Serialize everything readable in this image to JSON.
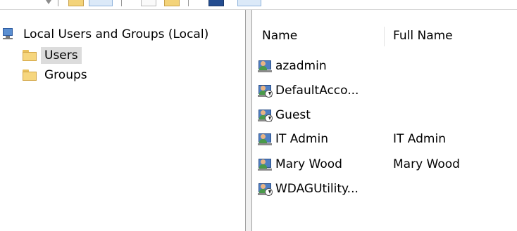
{
  "tree": {
    "root_label": "Local Users and Groups (Local)",
    "items": [
      {
        "label": "Users",
        "selected": true
      },
      {
        "label": "Groups",
        "selected": false
      }
    ]
  },
  "list": {
    "columns": [
      "Name",
      "Full Name"
    ],
    "users": [
      {
        "name": "azadmin",
        "full_name": "",
        "disabled": false
      },
      {
        "name": "DefaultAcco...",
        "full_name": "",
        "disabled": true
      },
      {
        "name": "Guest",
        "full_name": "",
        "disabled": true
      },
      {
        "name": "IT Admin",
        "full_name": "IT Admin",
        "disabled": false
      },
      {
        "name": "Mary Wood",
        "full_name": "Mary Wood",
        "disabled": false
      },
      {
        "name": "WDAGUtility...",
        "full_name": "",
        "disabled": true
      }
    ]
  },
  "icons": {
    "root": "computer-icon",
    "folder": "folder-icon",
    "user": "user-icon",
    "disabled_user": "disabled-user-icon"
  },
  "colors": {
    "selection": "#dcdcdc",
    "folder": "#f6d67e",
    "pane_border": "#a0a0a0"
  }
}
